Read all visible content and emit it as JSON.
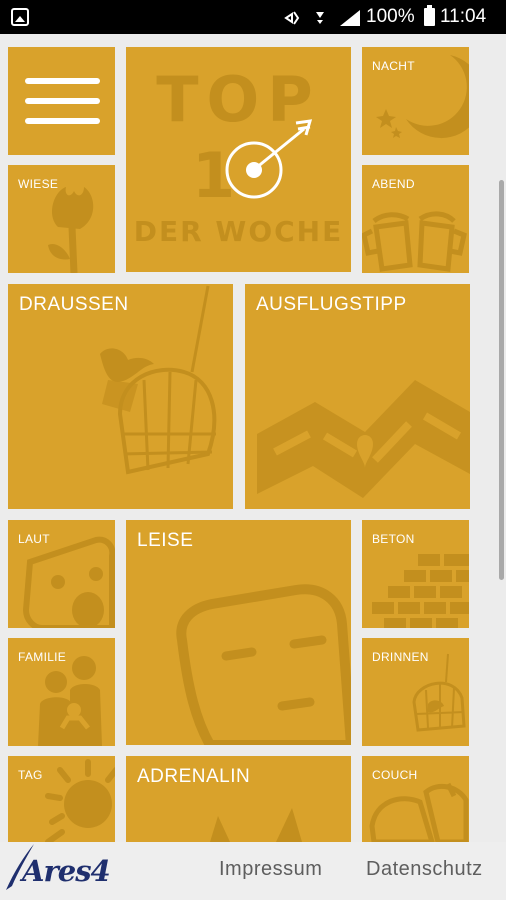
{
  "status_bar": {
    "battery_percent": "100%",
    "time": "11:04"
  },
  "tiles": {
    "top10": {
      "line1": "TOP",
      "line2": "1",
      "line3": "DER WOCHE"
    },
    "nacht": "NACHT",
    "wiese": "WIESE",
    "abend": "ABEND",
    "draussen": "DRAUSSEN",
    "ausflugstipp": "AUSFLUGSTIPP",
    "laut": "LAUT",
    "leise": "LEISE",
    "beton": "BETON",
    "familie": "FAMILIE",
    "drinnen": "DRINNEN",
    "tag": "TAG",
    "adrenalin": "ADRENALIN",
    "couch": "COUCH"
  },
  "footer": {
    "logo": "Ares4",
    "impressum": "Impressum",
    "datenschutz": "Datenschutz"
  },
  "colors": {
    "tile": "#d9a22b",
    "tile_art": "#c38f1e",
    "background": "#ececec"
  }
}
